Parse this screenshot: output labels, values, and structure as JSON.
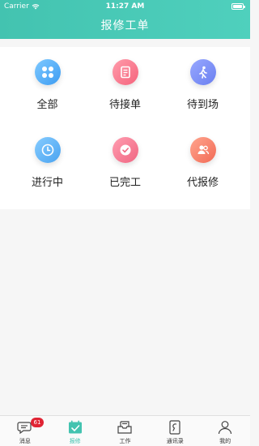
{
  "status_bar": {
    "carrier": "Carrier",
    "time": "11:27 AM"
  },
  "nav": {
    "title": "报修工单"
  },
  "grid": {
    "items": [
      {
        "label": "全部",
        "icon": "grid-clover-icon",
        "color": "#4aa3f0"
      },
      {
        "label": "待接单",
        "icon": "document-list-icon",
        "color": "#f5637c"
      },
      {
        "label": "待到场",
        "icon": "walking-person-icon",
        "color": "#6a7ff0"
      },
      {
        "label": "进行中",
        "icon": "clock-icon",
        "color": "#4aa3f0"
      },
      {
        "label": "已完工",
        "icon": "check-circle-icon",
        "color": "#f06682"
      },
      {
        "label": "代报修",
        "icon": "people-icon",
        "color": "#f26a55"
      }
    ]
  },
  "tabbar": {
    "items": [
      {
        "label": "消息",
        "icon": "chat-icon",
        "badge": "61"
      },
      {
        "label": "报修",
        "icon": "calendar-check-icon",
        "active": true
      },
      {
        "label": "工作",
        "icon": "inbox-icon"
      },
      {
        "label": "通讯录",
        "icon": "contacts-icon"
      },
      {
        "label": "我的",
        "icon": "user-icon"
      }
    ],
    "active_color": "#43c3b0"
  },
  "colors": {
    "header": "#43c3b0",
    "badge": "#e02434"
  }
}
